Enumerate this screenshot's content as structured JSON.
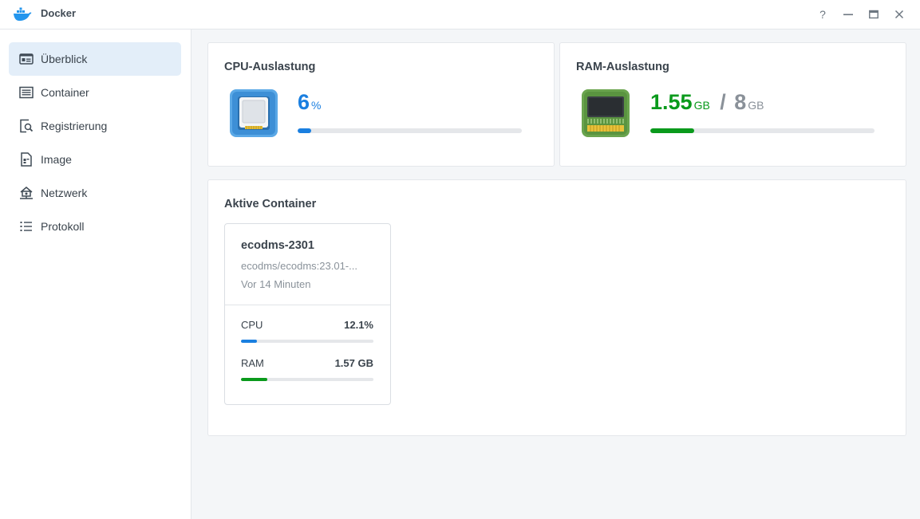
{
  "window": {
    "title": "Docker",
    "controls": [
      "help-icon",
      "minimize-icon",
      "maximize-icon",
      "close-icon"
    ]
  },
  "sidebar": {
    "items": [
      {
        "label": "Überblick",
        "icon": "overview-icon",
        "active": true
      },
      {
        "label": "Container",
        "icon": "container-list-icon",
        "active": false
      },
      {
        "label": "Registrierung",
        "icon": "registry-search-icon",
        "active": false
      },
      {
        "label": "Image",
        "icon": "image-file-icon",
        "active": false
      },
      {
        "label": "Netzwerk",
        "icon": "network-icon",
        "active": false
      },
      {
        "label": "Protokoll",
        "icon": "log-list-icon",
        "active": false
      }
    ]
  },
  "cpu": {
    "title": "CPU-Auslastung",
    "value": "6",
    "unit": "%",
    "fraction": 0.06,
    "color": "#1a7fe0"
  },
  "ram": {
    "title": "RAM-Auslastung",
    "used": "1.55",
    "used_unit": "GB",
    "separator": "/",
    "total": "8",
    "total_unit": "GB",
    "fraction": 0.194,
    "color": "#0a9a1c"
  },
  "active": {
    "title": "Aktive Container",
    "containers": [
      {
        "name": "ecodms-2301",
        "image": "ecodms/ecodms:23.01-...",
        "uptime": "Vor 14 Minuten",
        "cpu_label": "CPU",
        "cpu_value": "12.1%",
        "cpu_fraction": 0.121,
        "ram_label": "RAM",
        "ram_value": "1.57 GB",
        "ram_fraction": 0.196
      }
    ]
  }
}
